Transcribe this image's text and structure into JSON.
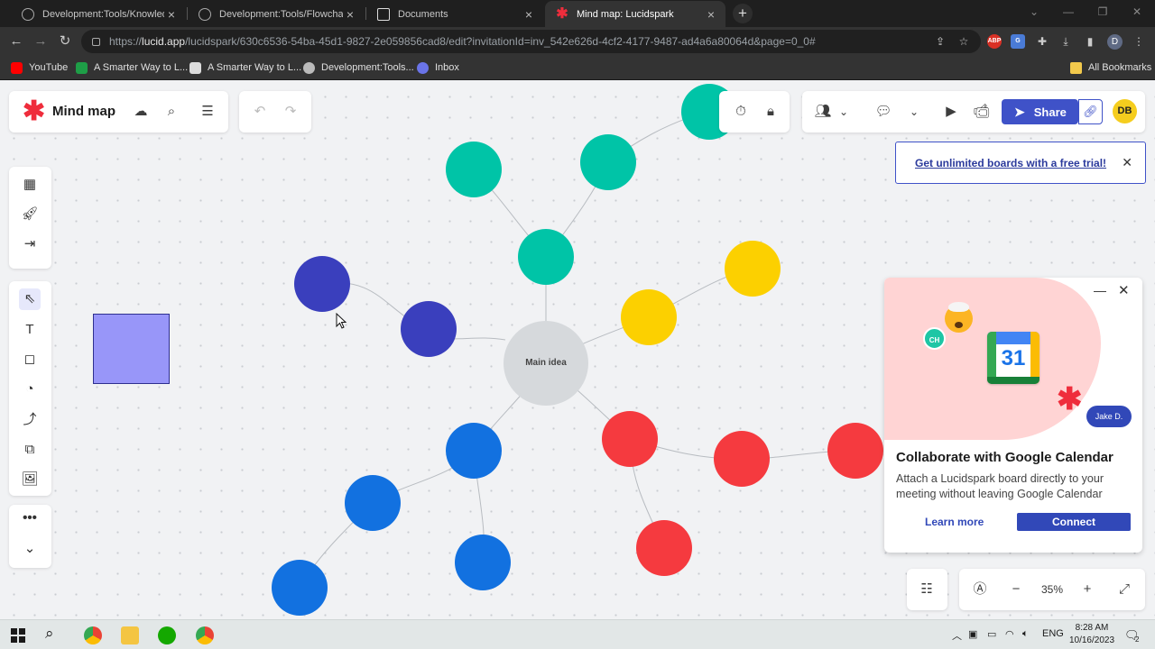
{
  "browser": {
    "tabs": [
      {
        "title": "Development:Tools/Knowledge",
        "active": false
      },
      {
        "title": "Development:Tools/Flowchart to",
        "active": false
      },
      {
        "title": "Documents",
        "active": false
      },
      {
        "title": "Mind map: Lucidspark",
        "active": true
      }
    ],
    "url_host": "lucid.app",
    "url_path": "/lucidspark/630c6536-54ba-45d1-9827-2e059856cad8/edit?invitationId=inv_542e626d-4cf2-4177-9487-ad4a6a80064d&page=0_0#",
    "profile_initial": "D",
    "bookmarks": [
      "YouTube",
      "A Smarter Way to L...",
      "A Smarter Way to L...",
      "Development:Tools...",
      "Inbox"
    ],
    "all_bookmarks": "All Bookmarks"
  },
  "app": {
    "doc_title": "Mind map",
    "share_label": "Share",
    "user_initials": "DB",
    "trial_banner": "Get unlimited boards with a free trial!",
    "central_node_label": "Main idea",
    "zoom": "35%",
    "accent": "#3f52c8",
    "node_colors": {
      "teal": "#00c4a7",
      "yellow": "#fcd000",
      "indigo": "#3a3fbd",
      "red": "#f53a3f",
      "blue": "#1271e0",
      "center": "#d6d9dc"
    }
  },
  "calendar_promo": {
    "title": "Collaborate with Google Calendar",
    "description": "Attach a Lucidspark board directly to your meeting without leaving Google Calendar",
    "learn_more": "Learn more",
    "connect": "Connect",
    "calendar_day": "31",
    "chip_ch": "CH",
    "chip_jake": "Jake D."
  },
  "taskbar": {
    "time": "8:28 AM",
    "date": "10/16/2023",
    "language": "ENG",
    "notifications": "2"
  }
}
